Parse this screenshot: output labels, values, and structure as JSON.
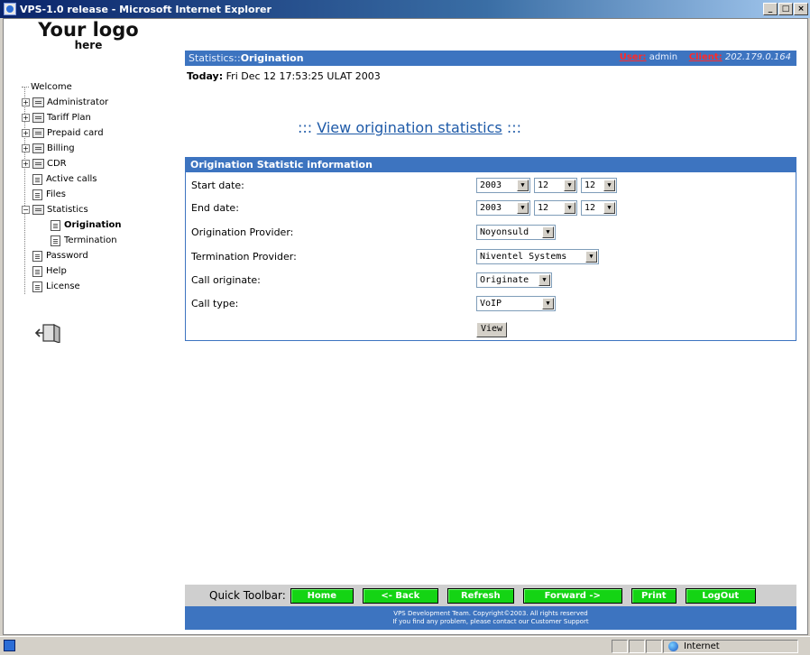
{
  "window": {
    "title": "VPS-1.0 release - Microsoft Internet Explorer",
    "controls": [
      "_",
      "□",
      "×"
    ]
  },
  "logo": {
    "line1": "Your logo",
    "line2": "here"
  },
  "menu": [
    {
      "label": "Welcome",
      "type": "root"
    },
    {
      "label": "Administrator",
      "type": "folder"
    },
    {
      "label": "Tariff Plan",
      "type": "folder"
    },
    {
      "label": "Prepaid card",
      "type": "folder"
    },
    {
      "label": "Billing",
      "type": "folder"
    },
    {
      "label": "CDR",
      "type": "folder"
    },
    {
      "label": "Active calls",
      "type": "doc"
    },
    {
      "label": "Files",
      "type": "doc"
    },
    {
      "label": "Statistics",
      "type": "folder-open"
    },
    {
      "label": "Origination",
      "type": "doc-child",
      "selected": true
    },
    {
      "label": "Termination",
      "type": "doc-child"
    },
    {
      "label": "Password",
      "type": "doc"
    },
    {
      "label": "Help",
      "type": "doc"
    },
    {
      "label": "License",
      "type": "doc"
    }
  ],
  "header": {
    "crumb_prefix": "Statistics::",
    "crumb_current": "Origination",
    "user_label": "User:",
    "user_value": "admin",
    "client_label": "Client:",
    "client_value": "202.179.0.164"
  },
  "today": {
    "label": "Today:",
    "value": "Fri Dec 12 17:53:25 ULAT 2003"
  },
  "view_title": {
    "prefix": ":::",
    "link": "View origination statistics",
    "suffix": ":::"
  },
  "form": {
    "heading": "Origination Statistic information",
    "start_date": {
      "label": "Start date:",
      "year": "2003",
      "month": "12",
      "day": "12"
    },
    "end_date": {
      "label": "End date:",
      "year": "2003",
      "month": "12",
      "day": "12"
    },
    "origination_provider": {
      "label": "Origination Provider:",
      "value": "Noyonsuld"
    },
    "termination_provider": {
      "label": "Termination Provider:",
      "value": "Niventel Systems"
    },
    "call_originate": {
      "label": "Call originate:",
      "value": "Originate"
    },
    "call_type": {
      "label": "Call type:",
      "value": "VoIP"
    },
    "view_button": "View"
  },
  "toolbar": {
    "label": "Quick Toolbar:",
    "home": "Home",
    "back": "<- Back",
    "refresh": "Refresh",
    "forward": "Forward ->",
    "print": "Print",
    "logout": "LogOut"
  },
  "footer": {
    "line1": "VPS Development Team. Copyright©2003. All rights reserved",
    "line2": "If you find any problem, please contact our Customer Support"
  },
  "statusbar": {
    "zone": "Internet"
  },
  "colors": {
    "accent": "#3d74c0",
    "toolbar_green": "#14d414",
    "alert_red": "#ff2a2a"
  }
}
